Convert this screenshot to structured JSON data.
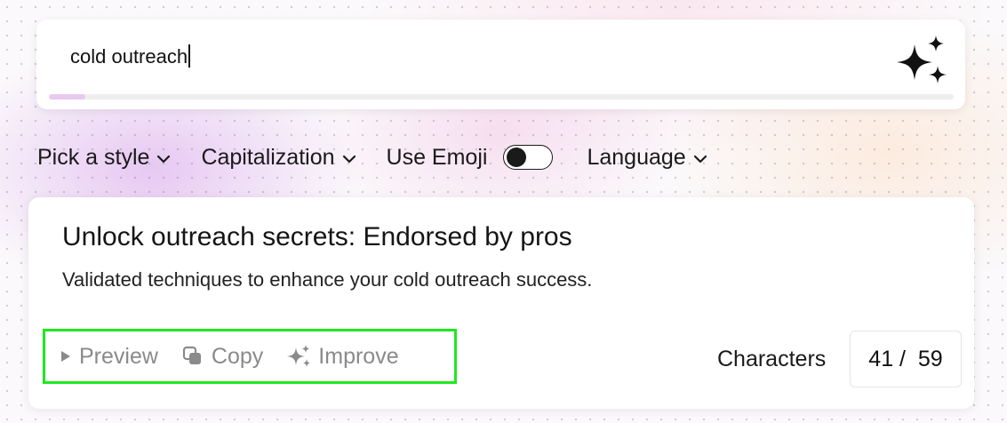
{
  "search": {
    "value": "cold outreach",
    "progress": 0.04
  },
  "options": {
    "style_label": "Pick a style",
    "capitalization_label": "Capitalization",
    "emoji_label": "Use Emoji",
    "emoji_enabled": false,
    "language_label": "Language"
  },
  "result": {
    "title": "Unlock outreach secrets: Endorsed by pros",
    "description": "Validated techniques to enhance your cold outreach success.",
    "actions": {
      "preview_label": "Preview",
      "copy_label": "Copy",
      "improve_label": "Improve"
    },
    "characters_label": "Characters",
    "characters_count": "41 /  59"
  },
  "colors": {
    "highlight_border": "#1ee81e",
    "progress_fill": "#e8c9ef"
  },
  "icons": [
    "sparkles-icon",
    "chevron-down-icon",
    "play-icon",
    "copy-icon",
    "sparkle-icon"
  ]
}
